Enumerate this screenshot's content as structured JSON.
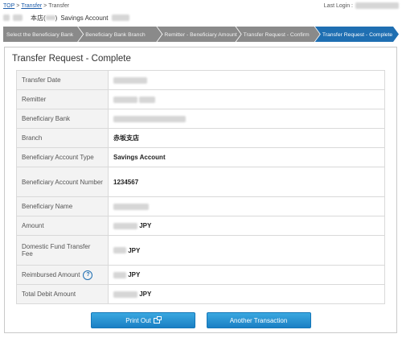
{
  "breadcrumb": {
    "top": "TOP",
    "sep": ">",
    "transfer": "Transfer",
    "current": "Transfer"
  },
  "header": {
    "last_login_label": "Last Login :"
  },
  "account": {
    "branch_label": "本店(",
    "branch_suffix": ")",
    "account_type": "Savings Account"
  },
  "steps": [
    {
      "label": "Select the Beneficiary Bank"
    },
    {
      "label": "Beneficiary Bank Branch"
    },
    {
      "label": "Remitter - Beneficiary Amount"
    },
    {
      "label": "Transfer Request - Confirm"
    },
    {
      "label": "Transfer Request - Complete"
    }
  ],
  "page": {
    "title": "Transfer Request - Complete"
  },
  "details": {
    "transfer_date": "Transfer Date",
    "remitter": "Remitter",
    "beneficiary_bank": "Beneficiary Bank",
    "branch": "Branch",
    "branch_value": "赤坂支店",
    "account_type": "Beneficiary Account Type",
    "account_type_value": "Savings Account",
    "account_number": "Beneficiary Account Number",
    "account_number_value": "1234567",
    "beneficiary_name": "Beneficiary Name",
    "amount": "Amount",
    "domestic_fee": "Domestic Fund Transfer Fee",
    "reimbursed_amount": "Reimbursed Amount",
    "total_debit": "Total Debit Amount",
    "currency": "JPY"
  },
  "buttons": {
    "print_out": "Print Out",
    "another_transaction": "Another Transaction"
  },
  "colors": {
    "accent": "#1f6fb2",
    "step_inactive": "#8a8a8a",
    "button": "#2a90d0"
  },
  "icons": {
    "help": "question-circle-icon",
    "external": "external-window-icon"
  }
}
